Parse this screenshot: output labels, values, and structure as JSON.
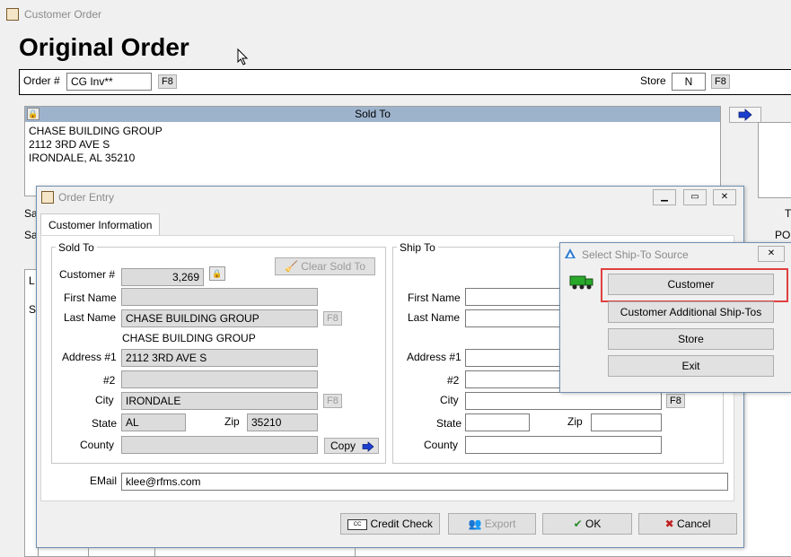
{
  "window": {
    "title": "Customer Order",
    "heading": "Original Order"
  },
  "order": {
    "order_label": "Order #",
    "order_value": "CG Inv**",
    "f8": "F8",
    "store_label": "Store",
    "store_value": "N",
    "store_f8": "F8"
  },
  "sold_to_header": {
    "label": "Sold To",
    "lines": [
      "CHASE BUILDING GROUP",
      "2112 3RD AVE S",
      "IRONDALE, AL  35210"
    ]
  },
  "side_labels": {
    "sa1": "Sa",
    "sa2": "Sa",
    "l": "L",
    "s": "S",
    "t": "T",
    "po": "PO"
  },
  "order_entry": {
    "title": "Order Entry",
    "tab_label": "Customer Information",
    "sold_to": {
      "group_title": "Sold To",
      "clear_label": "Clear Sold To",
      "customer_label": "Customer #",
      "customer_value": "3,269",
      "first_name_label": "First Name",
      "first_name_value": "",
      "last_name_label": "Last Name",
      "last_name_value": "CHASE BUILDING GROUP",
      "f8": "F8",
      "company_line": "CHASE BUILDING GROUP",
      "address1_label": "Address #1",
      "address1_value": "2112 3RD AVE S",
      "address2_label": "#2",
      "address2_value": "",
      "city_label": "City",
      "city_value": "IRONDALE",
      "city_f8": "F8",
      "state_label": "State",
      "state_value": "AL",
      "zip_label": "Zip",
      "zip_value": "35210",
      "county_label": "County",
      "county_value": "",
      "copy_label": "Copy"
    },
    "ship_to": {
      "group_title": "Ship To",
      "first_name_label": "First Name",
      "last_name_label": "Last Name",
      "address1_label": "Address #1",
      "address2_label": "#2",
      "city_label": "City",
      "city_f8": "F8",
      "state_label": "State",
      "zip_label": "Zip",
      "county_label": "County"
    },
    "email_label": "EMail",
    "email_value": "klee@rfms.com",
    "buttons": {
      "credit_check": "Credit Check",
      "export": "Export",
      "ok": "OK",
      "cancel": "Cancel"
    }
  },
  "ship_to_source": {
    "title": "Select Ship-To Source",
    "close": "✕",
    "options": [
      "Customer",
      "Customer Additional Ship-Tos",
      "Store",
      "Exit"
    ]
  },
  "colors": {
    "accent_bar": "#9db3cc",
    "highlight": "#e04040",
    "arrow_blue": "#1a3fd0",
    "ok_green": "#2a8a2a",
    "cancel_red": "#c02020"
  }
}
